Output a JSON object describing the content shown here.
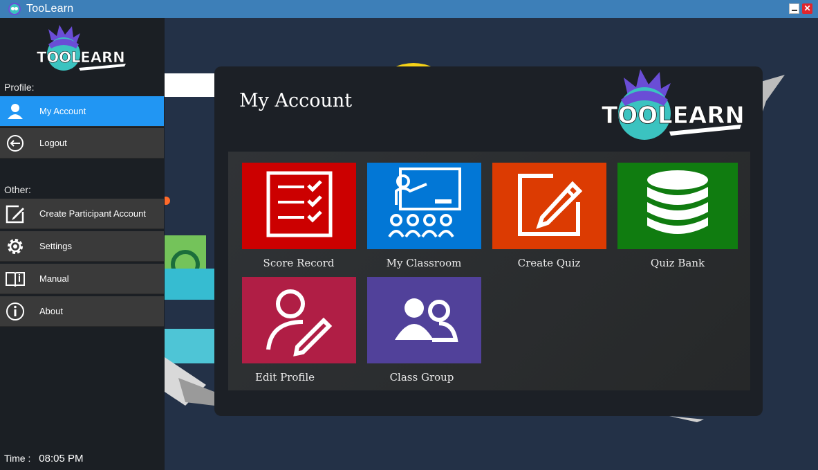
{
  "window": {
    "title": "TooLearn",
    "icon": "toolearn-app-icon"
  },
  "sidebar": {
    "logo_text": "TOOLEARN",
    "profile_label": "Profile:",
    "profile_items": [
      {
        "label": "My Account",
        "icon": "user-icon",
        "active": true
      },
      {
        "label": "Logout",
        "icon": "logout-icon",
        "active": false
      }
    ],
    "other_label": "Other:",
    "other_items": [
      {
        "label": "Create Participant Account",
        "icon": "edit-icon"
      },
      {
        "label": "Settings",
        "icon": "gear-icon"
      },
      {
        "label": "Manual",
        "icon": "book-icon"
      },
      {
        "label": "About",
        "icon": "info-icon"
      }
    ],
    "time_label": "Time :",
    "time_value": "08:05 PM"
  },
  "main": {
    "title": "My Account",
    "logo_text": "TOOLEARN",
    "tiles": [
      {
        "label": "Score Record",
        "icon": "checklist-icon",
        "color": "#cc0000"
      },
      {
        "label": "My Classroom",
        "icon": "classroom-icon",
        "color": "#0277d6"
      },
      {
        "label": "Create Quiz",
        "icon": "pencil-square-icon",
        "color": "#dc3b02"
      },
      {
        "label": "Quiz Bank",
        "icon": "database-icon",
        "color": "#107c10"
      },
      {
        "label": "Edit Profile",
        "icon": "user-edit-icon",
        "color": "#b01e45"
      },
      {
        "label": "Class Group",
        "icon": "users-icon",
        "color": "#51419a"
      }
    ]
  },
  "colors": {
    "titlebar": "#3d7fb8",
    "sidebar_bg": "#1b1f24",
    "nav_item_bg": "#3a3a3a",
    "nav_active": "#2196f3",
    "panel_bg": "#1c2026"
  }
}
